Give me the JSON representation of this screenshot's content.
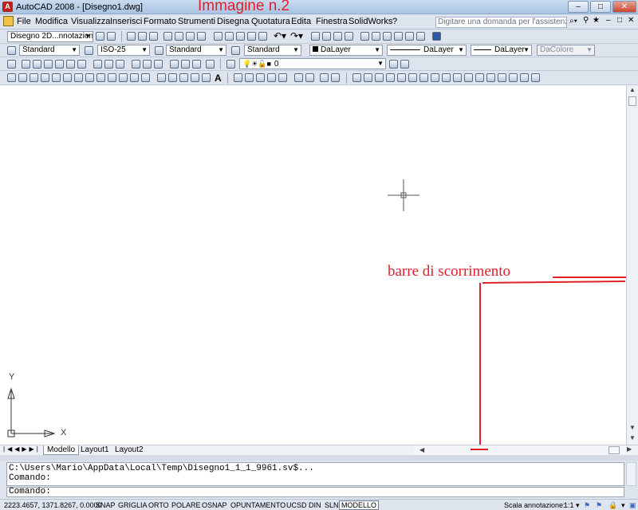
{
  "titlebar": {
    "app_title": "AutoCAD 2008 - [Disegno1.dwg]",
    "overlay": "Immagine n.2",
    "minimize": "–",
    "maximize": "□",
    "close": "✕"
  },
  "menubar": {
    "items": [
      "File",
      "Modifica",
      "Visualizza",
      "Inserisci",
      "Formato",
      "Strumenti",
      "Disegna",
      "Quotatura",
      "Edita",
      "Finestra",
      "SolidWorks",
      "?"
    ],
    "help_placeholder": "Digitare una domanda per l'assistenza",
    "doc_min": "–",
    "doc_max": "□",
    "doc_close": "✕"
  },
  "toolbar1": {
    "workspace": "Disegno 2D...nnotazione"
  },
  "toolbar2": {
    "text_style": "Standard",
    "dim_style": "ISO-25",
    "table_style": "Standard",
    "mleader_style": "Standard",
    "color": "DaLayer",
    "linetype": "DaLayer",
    "lineweight": "DaLayer",
    "plot_style": "DaColore"
  },
  "toolbar3": {
    "layer": "0"
  },
  "canvas": {
    "ucs_x": "X",
    "ucs_y": "Y"
  },
  "annotation": {
    "text": "barre di scorrimento",
    "color": "#e0202a"
  },
  "tabs": {
    "items": [
      "Modello",
      "Layout1",
      "Layout2"
    ],
    "active": "Modello"
  },
  "command": {
    "history_1": "C:\\Users\\Mario\\AppData\\Local\\Temp\\Disegno1_1_1_9961.sv$...",
    "history_2": "Comando:",
    "prompt": "Comando:"
  },
  "statusbar": {
    "coords": "2223.4657, 1371.8267, 0.0000",
    "toggles": [
      "SNAP",
      "GRIGLIA",
      "ORTO",
      "POLARE",
      "OSNAP",
      "OPUNTAMENTO",
      "UCSD",
      "DIN",
      "SLN",
      "MODELLO"
    ],
    "scale_label": "Scala annotazione:",
    "scale_value": "1:1 ▾"
  },
  "colors": {
    "accent_red": "#e0202a",
    "chrome": "#dde4ee"
  }
}
